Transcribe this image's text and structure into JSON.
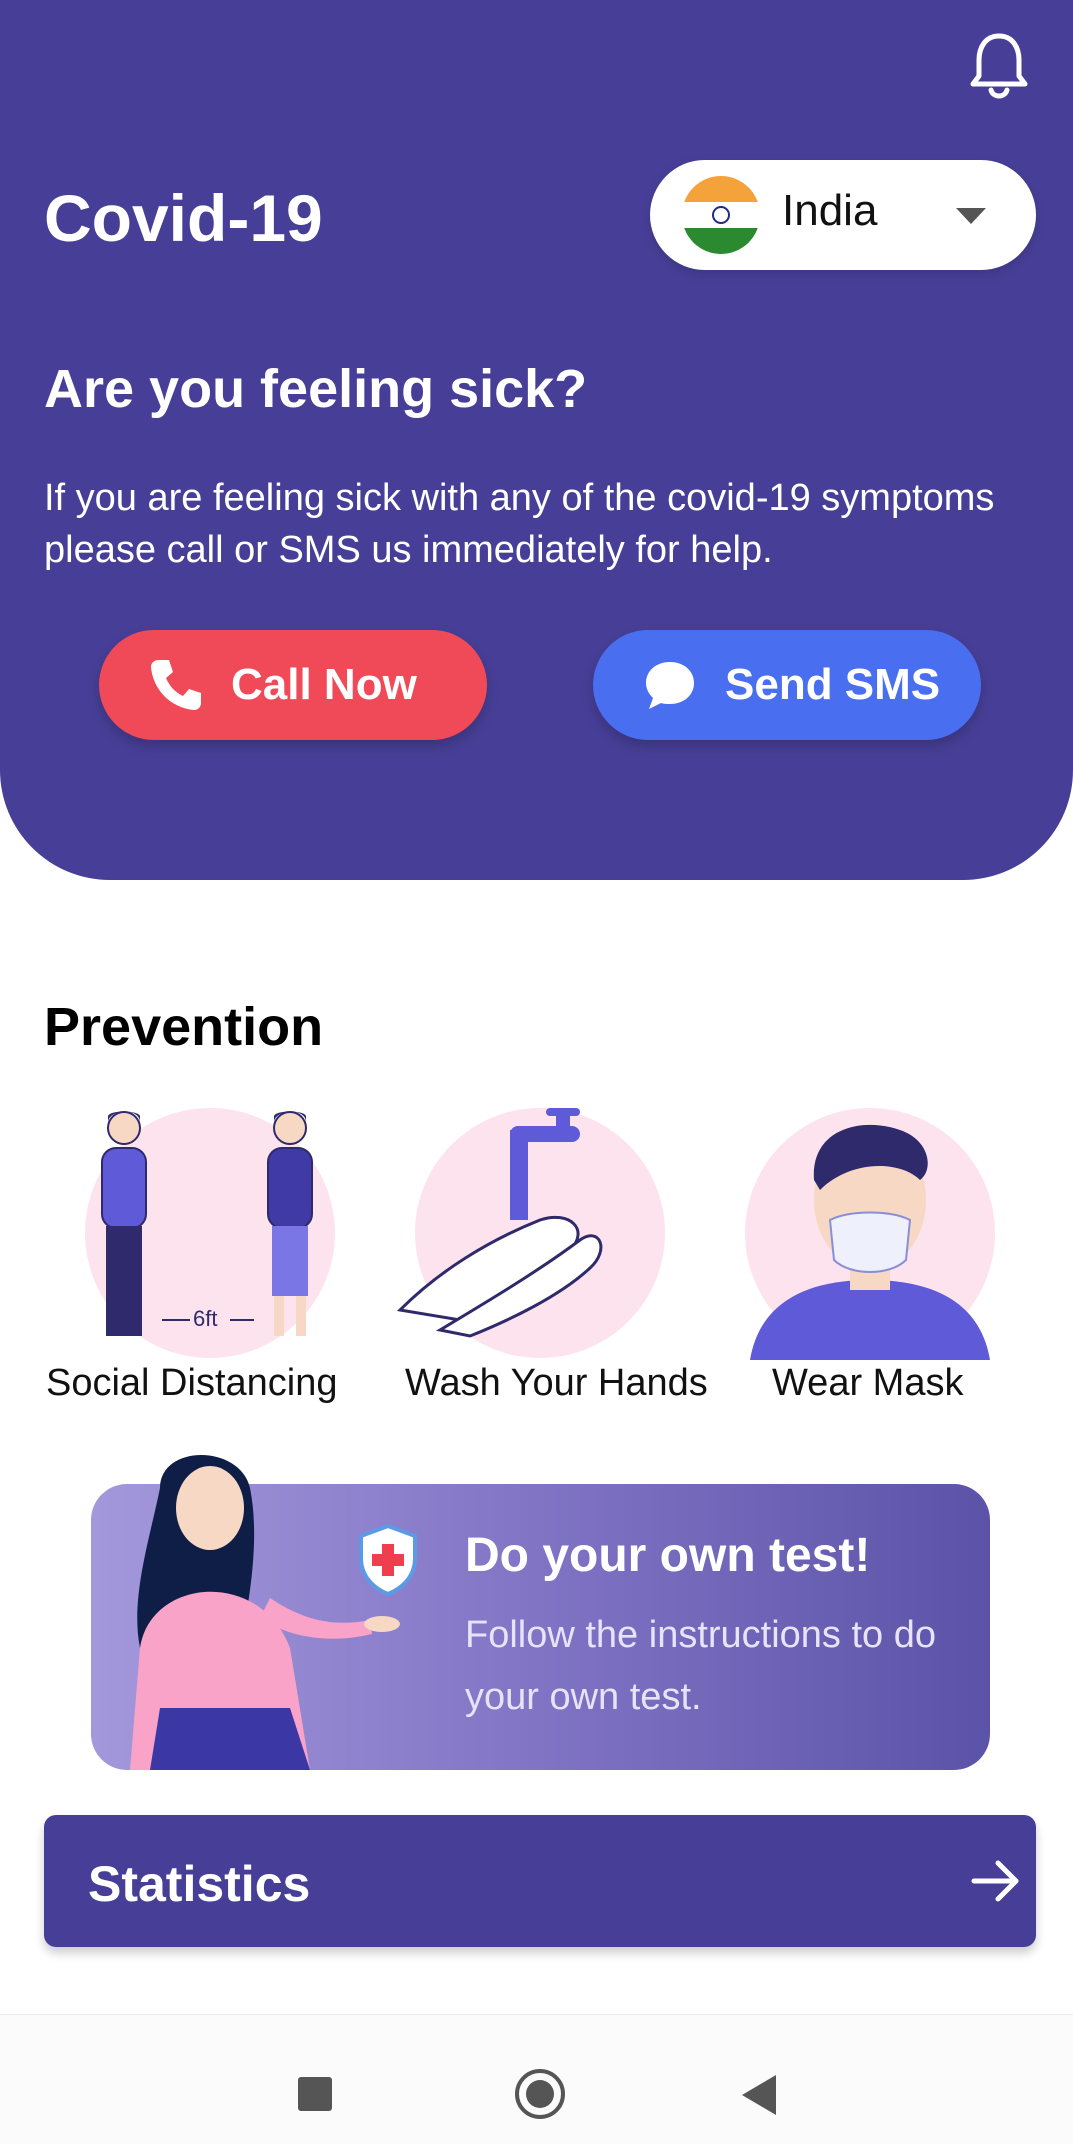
{
  "header": {
    "title": "Covid-19",
    "country": "India"
  },
  "alert": {
    "question": "Are you feeling sick?",
    "description_line1": "If you are feeling sick with any of the covid-19 symptoms",
    "description_line2": "please call or SMS us immediately for help.",
    "call_label": "Call Now",
    "sms_label": "Send SMS"
  },
  "prevention": {
    "title": "Prevention",
    "items": [
      {
        "label": "Social Distancing",
        "distance": "6ft"
      },
      {
        "label": "Wash Your Hands"
      },
      {
        "label": "Wear Mask"
      }
    ]
  },
  "test_card": {
    "title": "Do your own test!",
    "subtitle": "Follow the instructions to do your own test."
  },
  "statistics": {
    "label": "Statistics"
  },
  "colors": {
    "primary": "#473f97",
    "call": "#f04a58",
    "sms": "#4a6ef0",
    "illustration_bg": "#fde3ee"
  }
}
